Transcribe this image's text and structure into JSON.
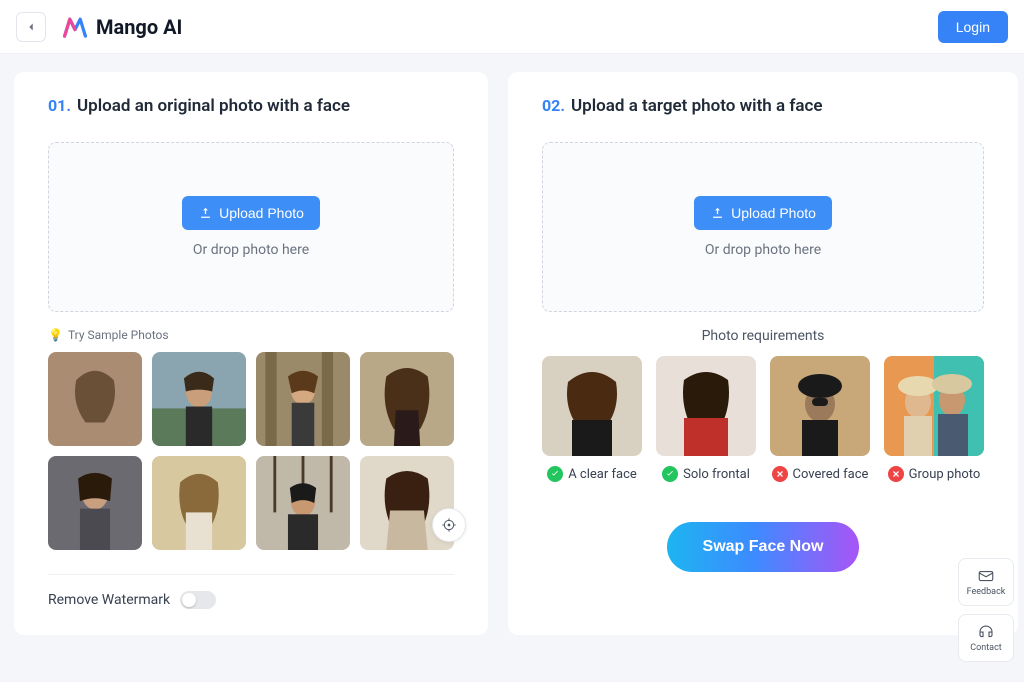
{
  "header": {
    "brand": "Mango AI",
    "login": "Login"
  },
  "left": {
    "step": "01.",
    "title": "Upload an original photo with a face",
    "upload_btn": "Upload Photo",
    "drop_text": "Or drop photo here",
    "sample_label": "Try Sample Photos",
    "watermark_label": "Remove Watermark"
  },
  "right": {
    "step": "02.",
    "title": "Upload a target photo with a face",
    "upload_btn": "Upload Photo",
    "drop_text": "Or drop photo here",
    "req_label": "Photo requirements",
    "reqs": [
      {
        "label": "A clear face",
        "ok": true
      },
      {
        "label": "Solo frontal",
        "ok": true
      },
      {
        "label": "Covered face",
        "ok": false
      },
      {
        "label": "Group photo",
        "ok": false
      }
    ],
    "swap_btn": "Swap Face Now"
  },
  "widgets": {
    "feedback": "Feedback",
    "contact": "Contact"
  }
}
